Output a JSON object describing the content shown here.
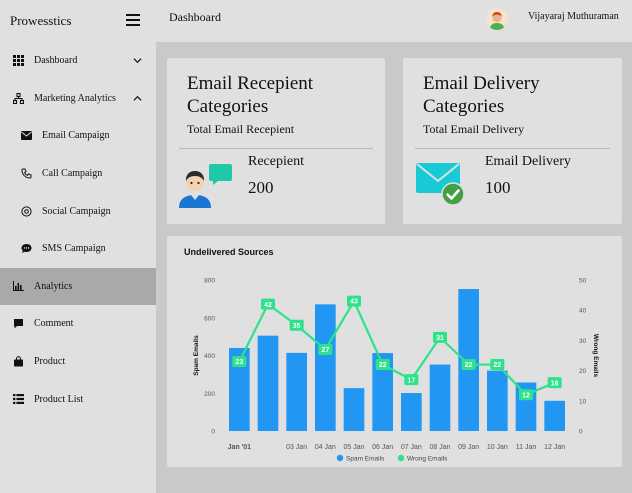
{
  "brand": "Prowesstics",
  "header": {
    "title": "Dashboard",
    "user_name": "Vijayaraj Muthuraman"
  },
  "sidebar": {
    "items": [
      {
        "label": "Dashboard",
        "icon": "grid-icon",
        "chevron": "chevron-down-icon"
      },
      {
        "label": "Marketing Analytics",
        "icon": "sitemap-icon",
        "chevron": "chevron-up-icon"
      },
      {
        "label": "Email Campaign",
        "icon": "envelope-icon"
      },
      {
        "label": "Call Campaign",
        "icon": "phone-icon"
      },
      {
        "label": "Social Campaign",
        "icon": "at-icon"
      },
      {
        "label": "SMS Campaign",
        "icon": "sms-icon"
      },
      {
        "label": "Analytics",
        "icon": "bar-chart-icon",
        "active": true
      },
      {
        "label": "Comment",
        "icon": "comment-icon"
      },
      {
        "label": "Product",
        "icon": "shopping-bag-icon"
      },
      {
        "label": "Product List",
        "icon": "list-icon"
      }
    ]
  },
  "cards": {
    "recipient": {
      "title": "Email Recepient Categories",
      "subtitle": "Total Email Recepient",
      "metric_label": "Recepient",
      "metric_value": "200"
    },
    "delivery": {
      "title": "Email Delivery Categories",
      "subtitle": "Total Email Delivery",
      "metric_label": "Email Delivery",
      "metric_value": "100"
    }
  },
  "chart_data": {
    "type": "bar",
    "title": "Undelivered Sources",
    "x": [
      "Jan '01",
      "02 Jan",
      "03 Jan",
      "04 Jan",
      "05 Jan",
      "06 Jan",
      "07 Jan",
      "08 Jan",
      "09 Jan",
      "10 Jan",
      "11 Jan",
      "12 Jan"
    ],
    "x_tick_labels": [
      "Jan '01",
      "",
      "03 Jan",
      "04 Jan",
      "05 Jan",
      "06 Jan",
      "07 Jan",
      "08 Jan",
      "09 Jan",
      "10 Jan",
      "11 Jan",
      "12 Jan"
    ],
    "series": [
      {
        "name": "Spam Emails",
        "type": "bar",
        "axis": "left",
        "color": "#2196f3",
        "values": [
          440,
          505,
          414,
          671,
          227,
          413,
          201,
          352,
          752,
          320,
          257,
          160
        ]
      },
      {
        "name": "Wrong Emails",
        "type": "line",
        "axis": "right",
        "color": "#2ee28c",
        "values": [
          23,
          42,
          35,
          27,
          43,
          22,
          17,
          31,
          22,
          22,
          12,
          16
        ]
      }
    ],
    "ylabel": "Spam Emails",
    "y2label": "Wrong Emails",
    "ylim": [
      0,
      800
    ],
    "yticks": [
      0,
      200,
      400,
      600,
      800
    ],
    "y2lim": [
      0,
      50
    ],
    "y2ticks": [
      0,
      10,
      20,
      30,
      40,
      50
    ],
    "legend": "bottom-center"
  }
}
